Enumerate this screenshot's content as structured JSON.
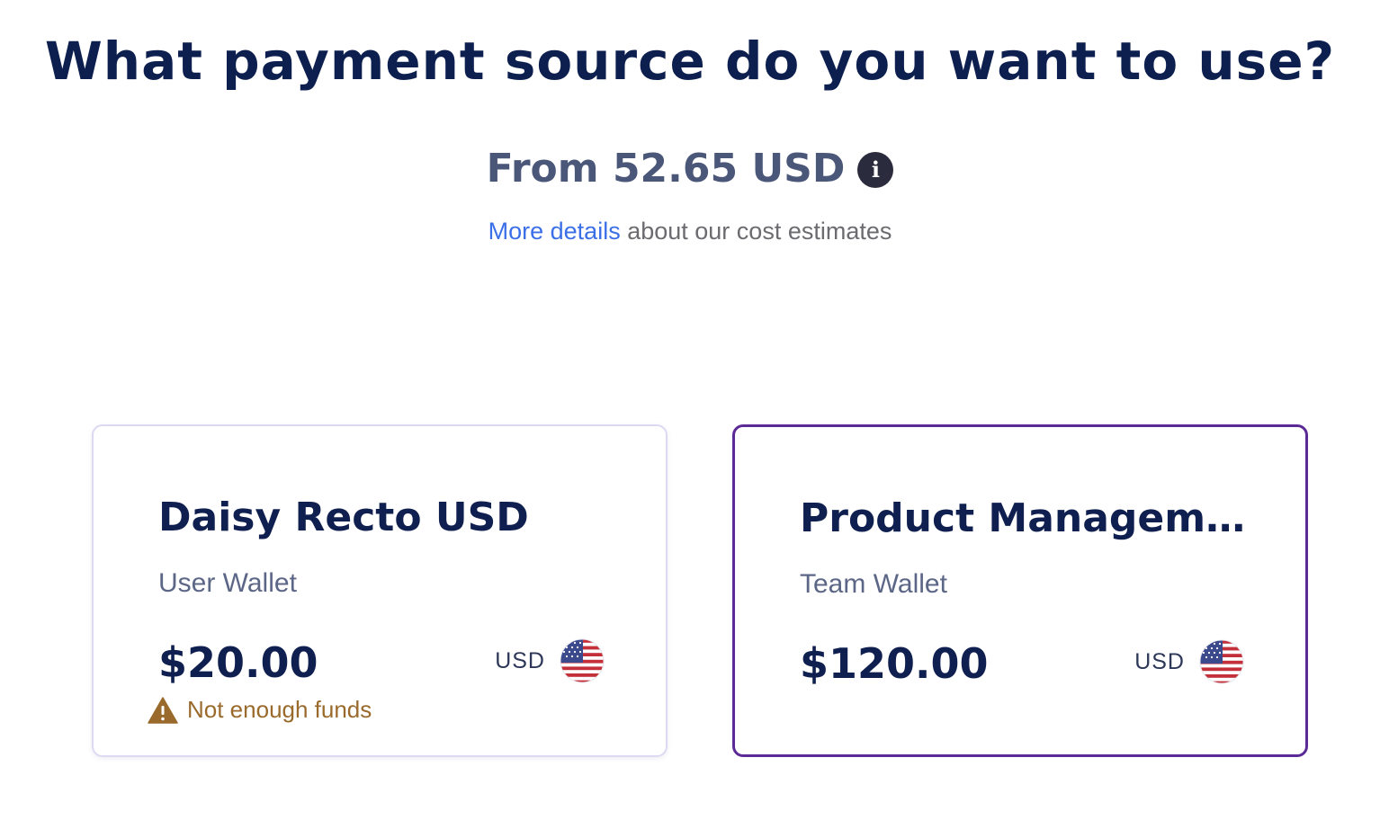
{
  "header": {
    "title": "What payment source do you want to use?",
    "cost_estimate": "From 52.65 USD",
    "info_icon": "info-icon",
    "details_link": "More details",
    "details_suffix": " about our cost estimates"
  },
  "wallets": [
    {
      "name": "Daisy Recto USD",
      "type": "User Wallet",
      "balance": "$20.00",
      "currency": "USD",
      "flag": "us-flag-icon",
      "warning": "Not enough funds",
      "warning_icon": "warning-icon",
      "selected": false
    },
    {
      "name": "Product Managem…",
      "type": "Team Wallet",
      "balance": "$120.00",
      "currency": "USD",
      "flag": "us-flag-icon",
      "selected": true
    }
  ],
  "colors": {
    "title": "#0d1f4f",
    "link": "#3b6fe8",
    "selected_border": "#5b2a96",
    "warning": "#9a6a2c",
    "card_border": "#ddd9f3"
  }
}
